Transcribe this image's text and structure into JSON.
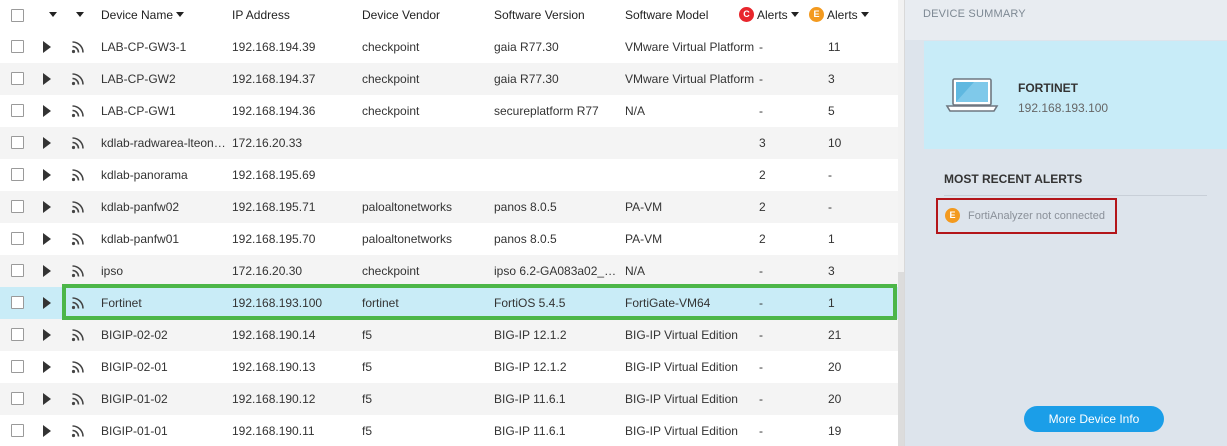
{
  "table": {
    "headers": {
      "device_name": "Device Name",
      "ip_address": "IP Address",
      "device_vendor": "Device Vendor",
      "software_version": "Software Version",
      "software_model": "Software Model",
      "critical_alerts_badge": "C",
      "critical_alerts": "Alerts",
      "error_alerts_badge": "E",
      "error_alerts": "Alerts"
    },
    "rows": [
      {
        "name": "LAB-CP-GW3-1",
        "ip": "192.168.194.39",
        "vendor": "checkpoint",
        "version": "gaia R77.30",
        "model": "VMware Virtual Platform",
        "crit": "-",
        "err": "11"
      },
      {
        "name": "LAB-CP-GW2",
        "ip": "192.168.194.37",
        "vendor": "checkpoint",
        "version": "gaia R77.30",
        "model": "VMware Virtual Platform",
        "crit": "-",
        "err": "3"
      },
      {
        "name": "LAB-CP-GW1",
        "ip": "192.168.194.36",
        "vendor": "checkpoint",
        "version": "secureplatform R77",
        "model": "N/A",
        "crit": "-",
        "err": "5"
      },
      {
        "name": "kdlab-radwarea-lteon…",
        "ip": "172.16.20.33",
        "vendor": "",
        "version": "",
        "model": "",
        "crit": "3",
        "err": "10"
      },
      {
        "name": "kdlab-panorama",
        "ip": "192.168.195.69",
        "vendor": "",
        "version": "",
        "model": "",
        "crit": "2",
        "err": "-"
      },
      {
        "name": "kdlab-panfw02",
        "ip": "192.168.195.71",
        "vendor": "paloaltonetworks",
        "version": "panos 8.0.5",
        "model": "PA-VM",
        "crit": "2",
        "err": "-"
      },
      {
        "name": "kdlab-panfw01",
        "ip": "192.168.195.70",
        "vendor": "paloaltonetworks",
        "version": "panos 8.0.5",
        "model": "PA-VM",
        "crit": "2",
        "err": "1"
      },
      {
        "name": "ipso",
        "ip": "172.16.20.30",
        "vendor": "checkpoint",
        "version": "ipso 6.2-GA083a02_…",
        "model": "N/A",
        "crit": "-",
        "err": "3"
      },
      {
        "name": "Fortinet",
        "ip": "192.168.193.100",
        "vendor": "fortinet",
        "version": "FortiOS 5.4.5",
        "model": "FortiGate-VM64",
        "crit": "-",
        "err": "1",
        "selected": true
      },
      {
        "name": "BIGIP-02-02",
        "ip": "192.168.190.14",
        "vendor": "f5",
        "version": "BIG-IP 12.1.2",
        "model": "BIG-IP Virtual Edition",
        "crit": "-",
        "err": "21"
      },
      {
        "name": "BIGIP-02-01",
        "ip": "192.168.190.13",
        "vendor": "f5",
        "version": "BIG-IP 12.1.2",
        "model": "BIG-IP Virtual Edition",
        "crit": "-",
        "err": "20"
      },
      {
        "name": "BIGIP-01-02",
        "ip": "192.168.190.12",
        "vendor": "f5",
        "version": "BIG-IP 11.6.1",
        "model": "BIG-IP Virtual Edition",
        "crit": "-",
        "err": "20"
      },
      {
        "name": "BIGIP-01-01",
        "ip": "192.168.190.11",
        "vendor": "f5",
        "version": "BIG-IP 11.6.1",
        "model": "BIG-IP Virtual Edition",
        "crit": "-",
        "err": "19"
      }
    ]
  },
  "side_panel": {
    "title": "DEVICE SUMMARY",
    "device_name": "FORTINET",
    "device_ip": "192.168.193.100",
    "recent_alerts_title": "MOST RECENT ALERTS",
    "alerts": [
      {
        "severity_badge": "E",
        "text": "FortiAnalyzer not connected"
      }
    ],
    "more_button": "More Device Info"
  },
  "icons": {
    "row_expand": "triangle-right-icon",
    "row_status": "rss-feed-icon",
    "device": "laptop-icon"
  },
  "colors": {
    "selected_row": "#c9ecf7",
    "selected_outline": "#4cb648",
    "critical": "#e8262c",
    "error": "#f39a1f",
    "button": "#1b9ee8",
    "alert_outline": "#b3151a"
  }
}
